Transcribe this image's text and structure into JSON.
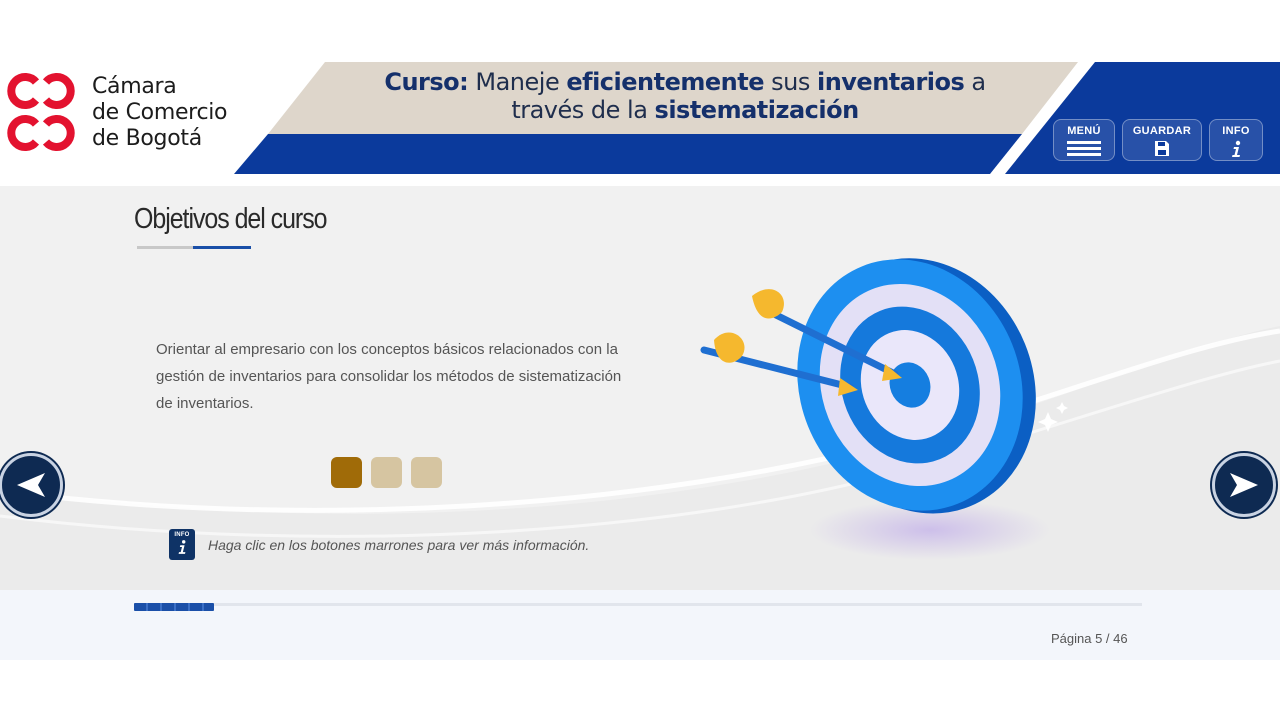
{
  "brand": {
    "name_lines": [
      "Cámara",
      "de Comercio",
      "de Bogotá"
    ],
    "colors": {
      "red": "#e3122f",
      "navy": "#0b3a9c",
      "beige": "#ded6cb",
      "gold": "#a06b08",
      "tan": "#d6c5a1"
    }
  },
  "header": {
    "title_parts": [
      {
        "text": "Curso:",
        "bold": true
      },
      {
        "text": " Maneje ",
        "bold": false
      },
      {
        "text": "eficientemente",
        "bold": true
      },
      {
        "text": " sus ",
        "bold": false
      },
      {
        "text": "inventarios",
        "bold": true
      },
      {
        "text": " a través de la ",
        "bold": false
      },
      {
        "text": "sistematización",
        "bold": true
      }
    ],
    "buttons": [
      {
        "label": "MENÚ",
        "icon": "menu-icon"
      },
      {
        "label": "GUARDAR",
        "icon": "save-icon"
      },
      {
        "label": "INFO",
        "icon": "info-icon"
      }
    ]
  },
  "content": {
    "section_title": "Objetivos del curso",
    "objective_text": "Orientar al empresario con los conceptos básicos relacionados con la gestión de inventarios para consolidar los métodos de sistematización de inventarios.",
    "dots": [
      {
        "state": "active",
        "color": "#a06b08"
      },
      {
        "state": "inactive",
        "color": "#d6c5a1"
      },
      {
        "state": "inactive",
        "color": "#d6c5a1"
      }
    ],
    "info_icon_label": "INFO",
    "info_note": "Haga clic en los botones marrones para ver más información."
  },
  "navigation": {
    "prev": "arrow-left-icon",
    "next": "arrow-right-icon"
  },
  "footer": {
    "page_label": "Página 5 / 46",
    "progress_fraction": 0.079
  }
}
